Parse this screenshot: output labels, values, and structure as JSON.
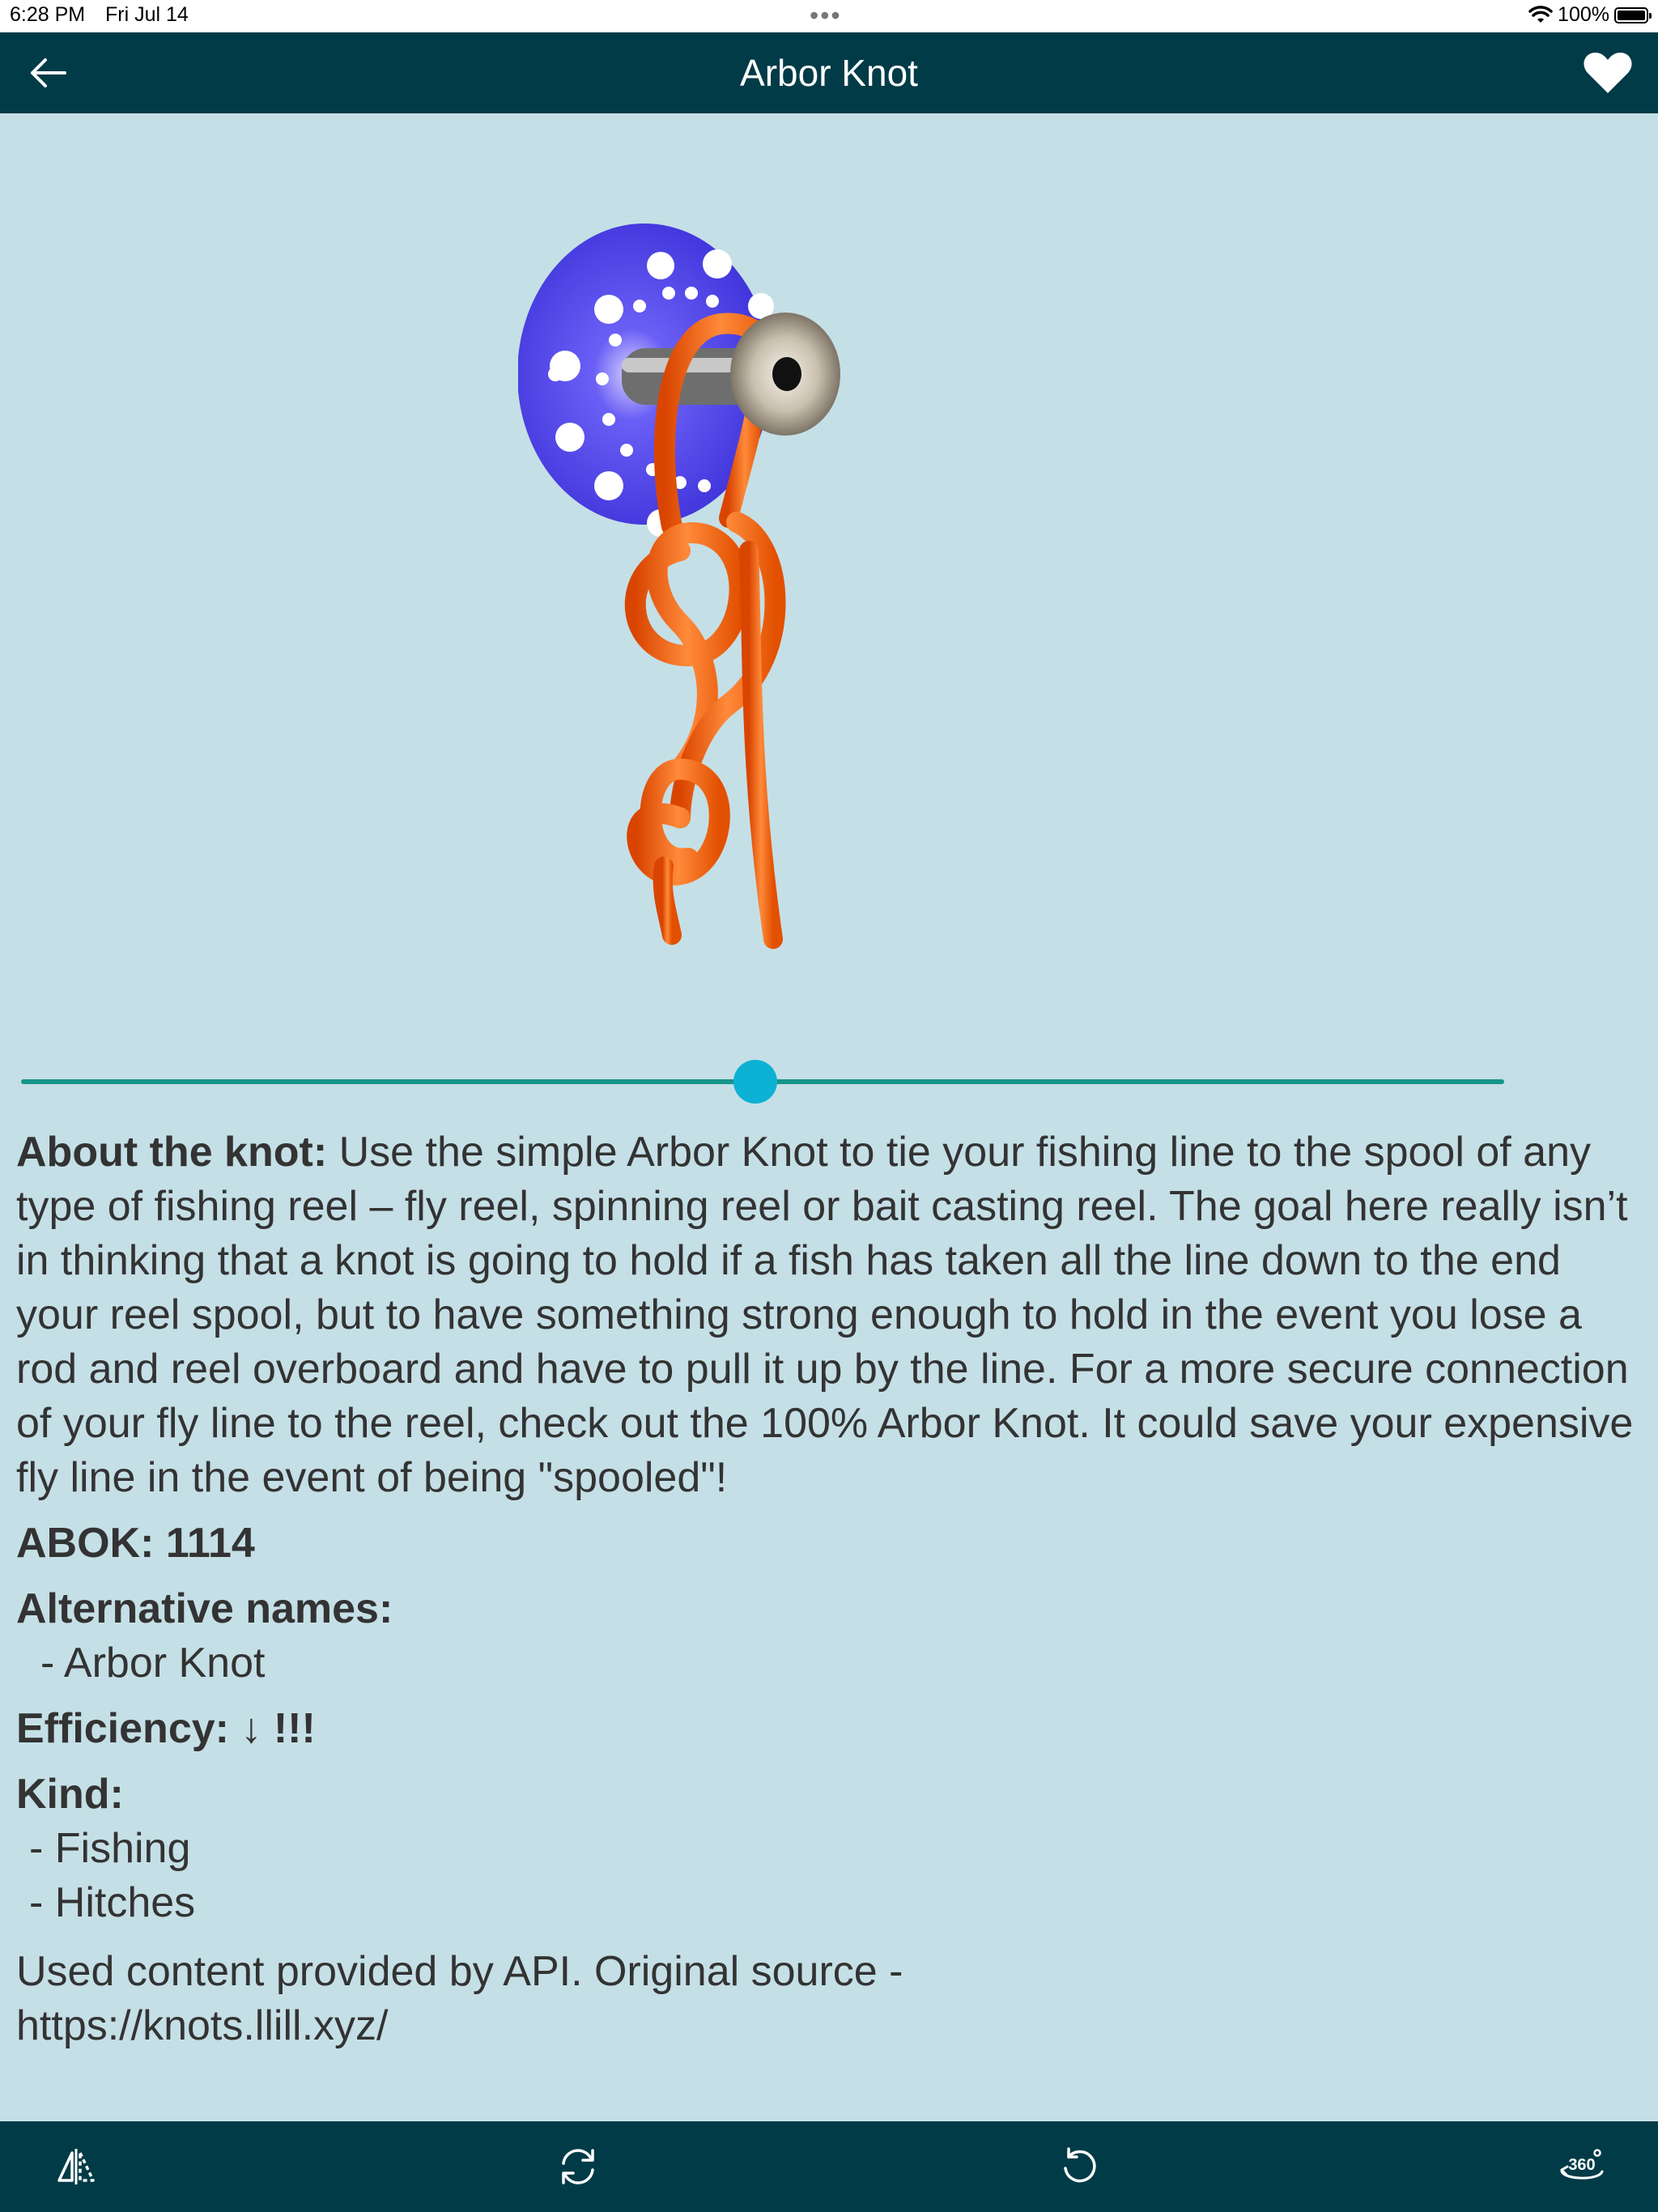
{
  "status_bar": {
    "time": "6:28 PM",
    "date": "Fri Jul 14",
    "battery": "100%",
    "battery_level": 1.0
  },
  "nav": {
    "title": "Arbor Knot",
    "back_icon": "back-arrow-icon",
    "favorite_icon": "heart-icon"
  },
  "slider": {
    "value": 0.495
  },
  "about": {
    "label": "About the knot:",
    "text": " Use the simple Arbor Knot to tie your fishing line to the spool of any type of fishing reel – fly reel, spinning reel or bait casting reel. The goal here really isn’t in thinking that a knot is going to hold if a fish has taken all the line down to the end your reel spool, but to have something strong enough to hold in the event you lose a rod and reel overboard and have to pull it up by the line. For a more secure connection of your fly line to the reel, check out the 100% Arbor Knot. It could save your expensive fly line in the event of being \"spooled\"!"
  },
  "abok": "ABOK: 1114",
  "alternative_names": {
    "label": "Alternative names:",
    "items": [
      "- Arbor Knot"
    ]
  },
  "efficiency": "Efficiency: ↓ !!!",
  "kind": {
    "label": "Kind:",
    "items": [
      "- Fishing",
      "- Hitches"
    ]
  },
  "credit": {
    "line1": "Used content provided by API. Original source -",
    "line2": "https://knots.llill.xyz/"
  },
  "toolbar": {
    "icons": [
      "mirror-icon",
      "refresh-icon",
      "rotate-icon",
      "view-360-icon"
    ]
  },
  "colors": {
    "header": "#003b47",
    "background": "#c5dfe6",
    "slider_track": "#17958a",
    "slider_thumb": "#0cb1d3",
    "knot_rope": "#ff6a14",
    "spool": "#5a4ff0"
  }
}
